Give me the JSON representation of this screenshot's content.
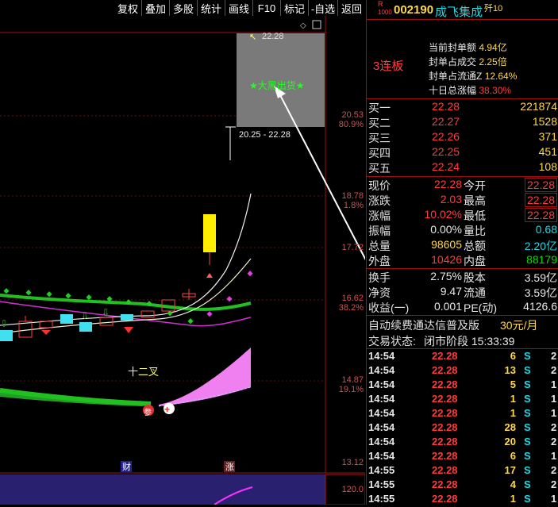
{
  "toolbar": {
    "buttons": [
      "复权",
      "叠加",
      "多股",
      "统计",
      "画线",
      "F10",
      "标记",
      "-自选",
      "返回"
    ]
  },
  "chart": {
    "price_labels": [
      "22.28",
      "20.53",
      "80.9%",
      "18.78",
      "1.8%",
      "17.72",
      "16.62",
      "38.2%",
      "14.87",
      "19.1%",
      "13.12"
    ],
    "popup": {
      "top_price": "22.28",
      "signal": "★大黑出货★",
      "range": "20.25 - 22.28"
    },
    "annotations": {
      "cross": "十二叉",
      "cai": "财",
      "zhang": "涨",
      "can": "参"
    },
    "indicator_value": "120.0"
  },
  "stock": {
    "code": "002190",
    "name": "成飞集成",
    "r_label": "R",
    "r_sub": "1000",
    "tag": "歼10"
  },
  "seal": {
    "streak": "3连板",
    "rows": [
      {
        "label": "当前封单额",
        "value": "4.94亿"
      },
      {
        "label": "封单占成交",
        "value": "2.25倍"
      },
      {
        "label": "封单占流通Z",
        "value": "12.64%"
      },
      {
        "label": "十日总涨幅",
        "value": "38.30%"
      }
    ]
  },
  "buy": [
    {
      "label": "买一",
      "price": "22.28",
      "vol": "221874"
    },
    {
      "label": "买二",
      "price": "22.27",
      "vol": "1528"
    },
    {
      "label": "买三",
      "price": "22.26",
      "vol": "371"
    },
    {
      "label": "买四",
      "price": "22.25",
      "vol": "451"
    },
    {
      "label": "买五",
      "price": "22.24",
      "vol": "108"
    }
  ],
  "quote": [
    {
      "l1": "现价",
      "v1": "22.28",
      "l2": "今开",
      "v2": "22.28"
    },
    {
      "l1": "涨跌",
      "v1": "2.03",
      "l2": "最高",
      "v2": "22.28"
    },
    {
      "l1": "涨幅",
      "v1": "10.02%",
      "l2": "最低",
      "v2": "22.28"
    },
    {
      "l1": "振幅",
      "v1": "0.00%",
      "l2": "量比",
      "v2": "0.68"
    },
    {
      "l1": "总量",
      "v1": "98605",
      "l2": "总额",
      "v2": "2.20亿"
    },
    {
      "l1": "外盘",
      "v1": "10426",
      "l2": "内盘",
      "v2": "88179"
    }
  ],
  "fund": [
    {
      "l1": "换手",
      "v1": "2.75%",
      "l2": "股本",
      "v2": "3.59亿"
    },
    {
      "l1": "净资",
      "v1": "9.47",
      "l2": "流通",
      "v2": "3.59亿"
    },
    {
      "l1": "收益(一)",
      "v1": "0.001",
      "l2": "PE(动)",
      "v2": "4126.6"
    }
  ],
  "ad": {
    "text": "自动续费通达信普及版",
    "price": "30元/月"
  },
  "status": {
    "label": "交易状态:",
    "value": "闭市阶段 15:33:39"
  },
  "ticks": [
    {
      "t": "14:54",
      "p": "22.28",
      "v": "6",
      "s": "S",
      "n": "2"
    },
    {
      "t": "14:54",
      "p": "22.28",
      "v": "13",
      "s": "S",
      "n": "2"
    },
    {
      "t": "14:54",
      "p": "22.28",
      "v": "5",
      "s": "S",
      "n": "1"
    },
    {
      "t": "14:54",
      "p": "22.28",
      "v": "1",
      "s": "S",
      "n": "1"
    },
    {
      "t": "14:54",
      "p": "22.28",
      "v": "1",
      "s": "S",
      "n": "1"
    },
    {
      "t": "14:54",
      "p": "22.28",
      "v": "28",
      "s": "S",
      "n": "2"
    },
    {
      "t": "14:54",
      "p": "22.28",
      "v": "20",
      "s": "S",
      "n": "2"
    },
    {
      "t": "14:54",
      "p": "22.28",
      "v": "6",
      "s": "S",
      "n": "1"
    },
    {
      "t": "14:55",
      "p": "22.28",
      "v": "17",
      "s": "S",
      "n": "2"
    },
    {
      "t": "14:55",
      "p": "22.28",
      "v": "4",
      "s": "S",
      "n": "2"
    },
    {
      "t": "14:55",
      "p": "22.28",
      "v": "1",
      "s": "S",
      "n": "1"
    }
  ]
}
